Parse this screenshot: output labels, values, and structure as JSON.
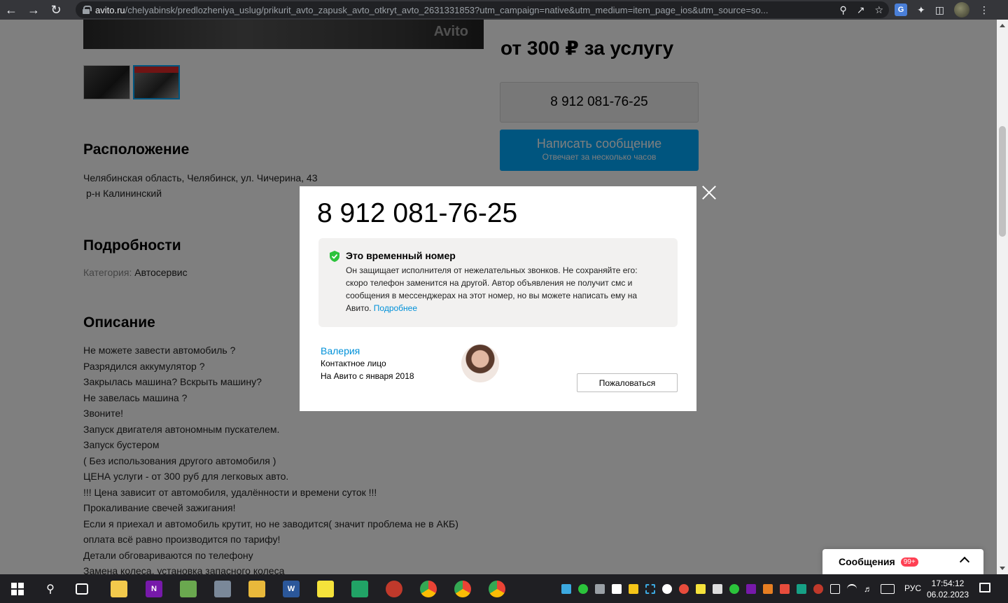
{
  "browser": {
    "url_host": "avito.ru",
    "url_path": "/chelyabinsk/predlozheniya_uslug/prikurit_avto_zapusk_avto_otkryt_avto_2631331853?utm_campaign=native&utm_medium=item_page_ios&utm_source=so..."
  },
  "page": {
    "watermark": "Avito",
    "location_title": "Расположение",
    "address": "Челябинская область, Челябинск, ул. Чичерина, 43",
    "district": "р-н Калининский",
    "details_title": "Подробности",
    "category_label": "Категория:",
    "category_value": "Автосервис",
    "description_title": "Описание",
    "description_lines": [
      "Не можете завести автомобиль ?",
      "Разрядился аккумулятор ?",
      "Закрылась машина? Вскрыть машину?",
      "Не завелась машина ?",
      "Звоните!",
      "Запуск двигателя автономным пускателем.",
      "Запуск бустером",
      "( Без использования другого автомобиля )",
      "ЦЕНА услуги - от 300 руб для легковых авто.",
      "!!! Цена зависит от автомобиля, удалённости и времени суток !!!",
      "Прокаливание свечей зажигания!",
      "Если я приехал и автомобиль крутит, но не заводится( значит проблема не в АКБ)",
      "оплата всё равно производится по тарифу!",
      "Детали обговариваются по телефону",
      "Замена колеса, установка запасного колеса"
    ],
    "price": "от 300 ₽ за услугу",
    "phone_button": "8 912 081-76-25",
    "message_button": "Написать сообщение",
    "message_sub": "Отвечает за несколько часов",
    "messages_label": "Сообщения",
    "messages_badge": "99+"
  },
  "modal": {
    "phone": "8 912 081-76-25",
    "notice_title": "Это временный номер",
    "notice_body": "Он защищает исполнителя от нежелательных звонков. Не сохраняйте его: скоро телефон заменится на другой. Автор объявления не получит смс и сообщения в мессенджерах на этот номер, но вы можете написать ему на Авито.",
    "notice_link": "Подробнее",
    "seller_name": "Валерия",
    "seller_role": "Контактное лицо",
    "seller_since": "На Авито с января 2018",
    "report_button": "Пожаловаться"
  },
  "taskbar": {
    "lang": "РУС",
    "time": "17:54:12",
    "date": "06.02.2023"
  },
  "colors": {
    "accent": "#00aaff",
    "link": "#0091d9",
    "shield": "#2bc33b",
    "badge": "#ff4053"
  }
}
